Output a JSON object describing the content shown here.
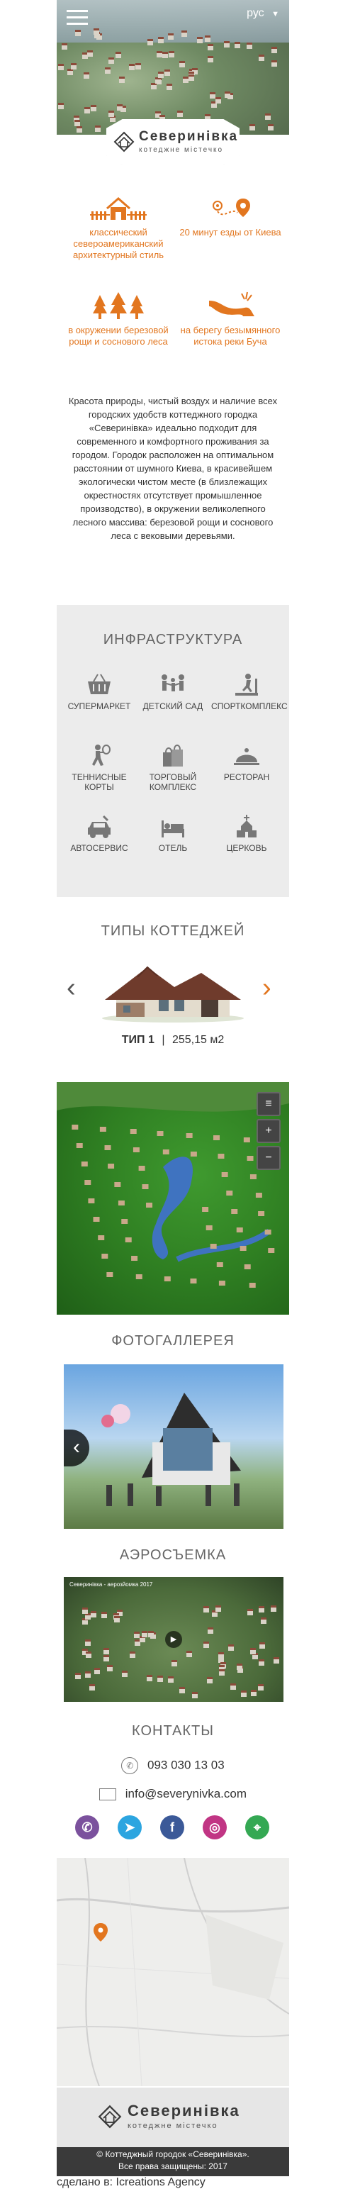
{
  "header": {
    "language": "рус",
    "logo": {
      "title": "Северинiвка",
      "subtitle": "котеджне мiстечко"
    }
  },
  "features": [
    {
      "icon": "house-fence-icon",
      "text": "классический североамериканский архитектурный стиль"
    },
    {
      "icon": "route-pin-icon",
      "text": "20 минут езды от Киева"
    },
    {
      "icon": "forest-trees-icon",
      "text": "в окружении березовой рощи и соснового леса"
    },
    {
      "icon": "river-source-icon",
      "text": "на берегу безымянного истока реки Буча"
    }
  ],
  "about": "Красота природы, чистый воздух и наличие всех городских удобств коттеджного городка «Северинiвка» идеально подходит для современного и комфортного проживания за городом. Городок расположен на оптимальном расстоянии от шумного Киева, в красивейшем экологически чистом месте (в близлежащих окрестностях отсутствует промышленное производство), в окружении великолепного лесного массива: березовой рощи и соснового леса с вековыми деревьями.",
  "infrastructure": {
    "title": "ИНФРАСТРУКТУРА",
    "items": [
      {
        "icon": "shopping-basket-icon",
        "label": "СУПЕРМАРКЕТ"
      },
      {
        "icon": "kindergarten-icon",
        "label": "ДЕТСКИЙ САД"
      },
      {
        "icon": "treadmill-icon",
        "label": "СПОРТКОМПЛЕКС"
      },
      {
        "icon": "tennis-player-icon",
        "label": "ТЕННИСНЫЕ КОРТЫ"
      },
      {
        "icon": "shopping-bags-icon",
        "label": "ТОРГОВЫЙ КОМПЛЕКС"
      },
      {
        "icon": "cloche-icon",
        "label": "РЕСТОРАН"
      },
      {
        "icon": "car-service-icon",
        "label": "АВТОСЕРВИС"
      },
      {
        "icon": "hotel-bed-icon",
        "label": "ОТЕЛЬ"
      },
      {
        "icon": "church-icon",
        "label": "ЦЕРКОВЬ"
      }
    ]
  },
  "cottages": {
    "title": "ТИПЫ КОТТЕДЖЕЙ",
    "type_label": "ТИП 1",
    "separator": "|",
    "area": "255,15 м2"
  },
  "gallery": {
    "title": "ФОТОГАЛЛЕРЕЯ"
  },
  "aerial": {
    "title": "АЭРОСЪЕМКА",
    "video_caption": "Северинівка - аерозйомка 2017"
  },
  "contacts": {
    "title": "КОНТАКТЫ",
    "phone": "093 030 13 03",
    "email": "info@severynivka.com",
    "socials": [
      {
        "icon": "viber-icon",
        "color": "#7b519d"
      },
      {
        "icon": "telegram-icon",
        "color": "#2ca5e0"
      },
      {
        "icon": "facebook-icon",
        "color": "#3b5998"
      },
      {
        "icon": "instagram-icon",
        "color": "#c13584"
      },
      {
        "icon": "google-maps-icon",
        "color": "#34a853"
      }
    ]
  },
  "footer": {
    "logo": {
      "title": "Северинiвка",
      "subtitle": "котеджне мiстечко"
    },
    "copyright": "© Коттеджный городок «Северинiвка».",
    "rights": "Все права защищены: 2017",
    "made_by": "сделано в: Icreations Agency"
  },
  "colors": {
    "accent": "#e2761f",
    "infra_bg": "#ececec",
    "footer_bg": "#3a3a3a"
  }
}
